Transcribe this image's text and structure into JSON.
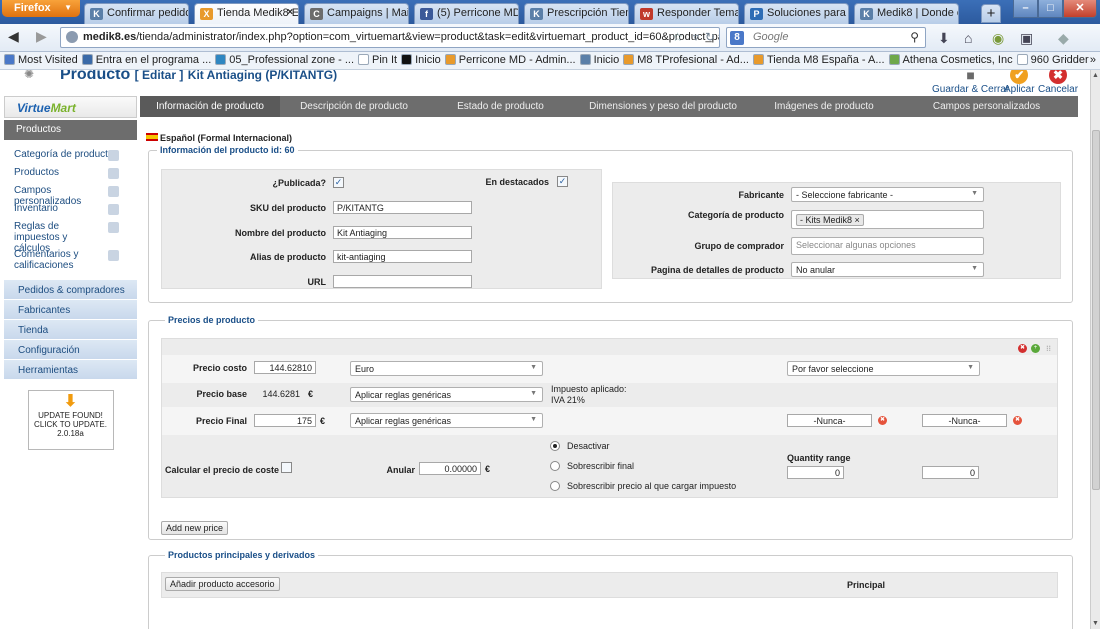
{
  "browser": {
    "firefox_label": "Firefox",
    "tabs": [
      {
        "label": "Confirmar pedido",
        "icon": "K",
        "color": "#5a7fa8"
      },
      {
        "label": "Tienda Medik8 E...",
        "icon": "X",
        "color": "#e89a2c",
        "active": true
      },
      {
        "label": "Campaigns | MailC...",
        "icon": "C",
        "color": "#6c6c6c"
      },
      {
        "label": "(5) Perricone MD Es...",
        "icon": "f",
        "color": "#3b5998"
      },
      {
        "label": "Prescripción Tiend...",
        "icon": "K",
        "color": "#5a7fa8"
      },
      {
        "label": "Responder Tema: P...",
        "icon": "w",
        "color": "#c0392b"
      },
      {
        "label": "Soluciones para em...",
        "icon": "P",
        "color": "#2e6db5"
      },
      {
        "label": "Medik8 | Donde co...",
        "icon": "K",
        "color": "#5a7fa8"
      }
    ],
    "tab_close": "×",
    "new_tab": "+",
    "url_host": "medik8.es",
    "url_rest": "/tienda/administrator/index.php?option=com_virtuemart&view=product&task=edit&virtuemart_product_id=60&product_parer",
    "search_placeholder": "Google",
    "bookmarks": [
      {
        "label": "Most Visited",
        "color": "#4a78c8"
      },
      {
        "label": "Entra en el programa ...",
        "color": "#3a6aa8"
      },
      {
        "label": "05_Professional zone - ...",
        "color": "#2e86c1"
      },
      {
        "label": "Pin It",
        "color": "#ffffff"
      },
      {
        "label": "Inicio",
        "color": "#111111"
      },
      {
        "label": "Perricone MD - Admin...",
        "color": "#e89a2c"
      },
      {
        "label": "Inicio",
        "color": "#5a7fa8"
      },
      {
        "label": "M8 TProfesional - Ad...",
        "color": "#e89a2c"
      },
      {
        "label": "Tienda M8 España - A...",
        "color": "#e89a2c"
      },
      {
        "label": "Athena Cosmetics, Inc",
        "color": "#6fa84a"
      },
      {
        "label": "960 Gridder",
        "color": "#ffffff"
      }
    ],
    "bookmarks_more": "»"
  },
  "header": {
    "title": "Producto",
    "action": "[ Editar ]",
    "product": "Kit Antiaging (P/KITANTG)",
    "buttons": [
      {
        "label": "Guardar & Cerrar",
        "color": "#6a6a6a",
        "icon": "■"
      },
      {
        "label": "Aplicar",
        "color": "#f0a020",
        "icon": "✔"
      },
      {
        "label": "Cancelar",
        "color": "#d32f2f",
        "icon": "✖"
      }
    ]
  },
  "sidebar": {
    "logo_a": "Virtue",
    "logo_b": "Mart",
    "products_header": "Productos",
    "items": [
      {
        "label": "Categoría de producto"
      },
      {
        "label": "Productos"
      },
      {
        "label": "Campos personalizados"
      },
      {
        "label": "Inventario"
      },
      {
        "label": "Reglas de impuestos y cálculos",
        "two": true
      },
      {
        "label": "Comentarios y calificaciones",
        "two": true
      }
    ],
    "categories": [
      "Pedidos & compradores",
      "Fabricantes",
      "Tienda",
      "Configuración",
      "Herramientas"
    ],
    "update_arrow": "⬇",
    "update_lines": [
      "UPDATE FOUND!",
      "CLICK TO UPDATE.",
      "2.0.18a"
    ]
  },
  "tabs": [
    {
      "label": "Información de producto",
      "active": true
    },
    {
      "label": "Descripción de producto"
    },
    {
      "label": "Estado de producto"
    },
    {
      "label": "Dimensiones y peso del producto"
    },
    {
      "label": "Imágenes de producto"
    },
    {
      "label": "Campos personalizados"
    }
  ],
  "info": {
    "language": "Español (Formal Internacional)",
    "legend": "Información del producto id: 60",
    "publicada_label": "¿Publicada?",
    "destacados_label": "En destacados",
    "sku_label": "SKU del producto",
    "sku_value": "P/KITANTG",
    "name_label": "Nombre del producto",
    "name_value": "Kit Antiaging",
    "alias_label": "Alias de producto",
    "alias_value": "kit-antiaging",
    "url_label": "URL",
    "url_value": "",
    "fabricante_label": "Fabricante",
    "fabricante_value": "- Seleccione fabricante -",
    "categoria_label": "Categoría de producto",
    "categoria_chip": "- Kits Medik8",
    "chip_x": "×",
    "grupo_label": "Grupo de comprador",
    "grupo_placeholder": "Seleccionar algunas opciones",
    "pagina_label": "Pagina de detalles de producto",
    "pagina_value": "No anular",
    "check": "✓"
  },
  "prices": {
    "legend": "Precios de producto",
    "costo_label": "Precio costo",
    "costo_value": "144.62810",
    "currency": "Euro",
    "shopper_select": "Por favor seleccione",
    "base_label": "Precio base",
    "base_value": "144.6281",
    "euro": "€",
    "rules_1": "Aplicar reglas genéricas",
    "tax_label": "Impuesto aplicado:",
    "tax_value": "IVA 21%",
    "final_label": "Precio Final",
    "final_value": "175",
    "rules_2": "Aplicar reglas genéricas",
    "nunca_1": "-Nunca-",
    "nunca_2": "-Nunca-",
    "calc_label": "Calcular el precio de coste",
    "anular_label": "Anular",
    "anular_value": "0.00000",
    "radio_1": "Desactivar",
    "radio_2": "Sobrescribir final",
    "radio_3": "Sobrescribir precio al que cargar impuesto",
    "qty_label": "Quantity range",
    "qty_from": "0",
    "qty_to": "0",
    "add_price": "Add new price"
  },
  "related": {
    "legend": "Productos principales y derivados",
    "add_accessory": "Añadir producto accesorio",
    "principal": "Principal"
  }
}
